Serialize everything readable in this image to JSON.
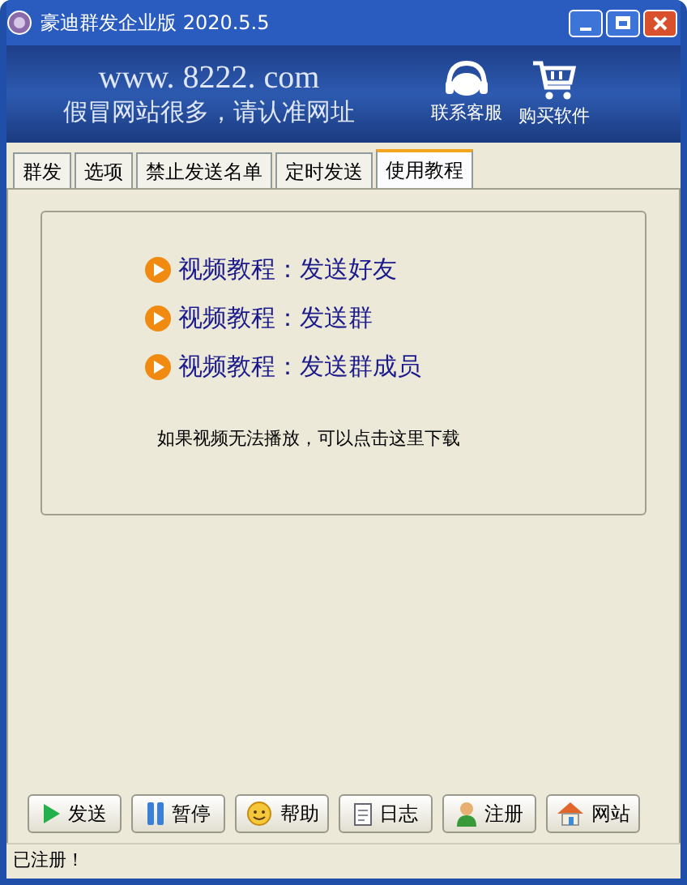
{
  "window": {
    "title": "豪迪群发企业版 2020.5.5"
  },
  "banner": {
    "url": "www. 8222. com",
    "slogan": "假冒网站很多，请认准网址",
    "actions": [
      {
        "kind": "support",
        "label": "联系客服"
      },
      {
        "kind": "cart",
        "label": "购买软件"
      }
    ]
  },
  "tabs": [
    {
      "label": "群发",
      "selected": false
    },
    {
      "label": "选项",
      "selected": false
    },
    {
      "label": "禁止发送名单",
      "selected": false
    },
    {
      "label": "定时发送",
      "selected": false
    },
    {
      "label": "使用教程",
      "selected": true
    }
  ],
  "tutorials": [
    "视频教程：发送好友",
    "视频教程：发送群",
    "视频教程：发送群成员"
  ],
  "download_note": "如果视频无法播放，可以点击这里下载",
  "buttons": [
    {
      "kind": "play",
      "label": "发送"
    },
    {
      "kind": "pause",
      "label": "暂停"
    },
    {
      "kind": "smiley",
      "label": "帮助"
    },
    {
      "kind": "doc",
      "label": "日志"
    },
    {
      "kind": "user",
      "label": "注册"
    },
    {
      "kind": "home",
      "label": "网站"
    }
  ],
  "status_bar": "已注册！"
}
